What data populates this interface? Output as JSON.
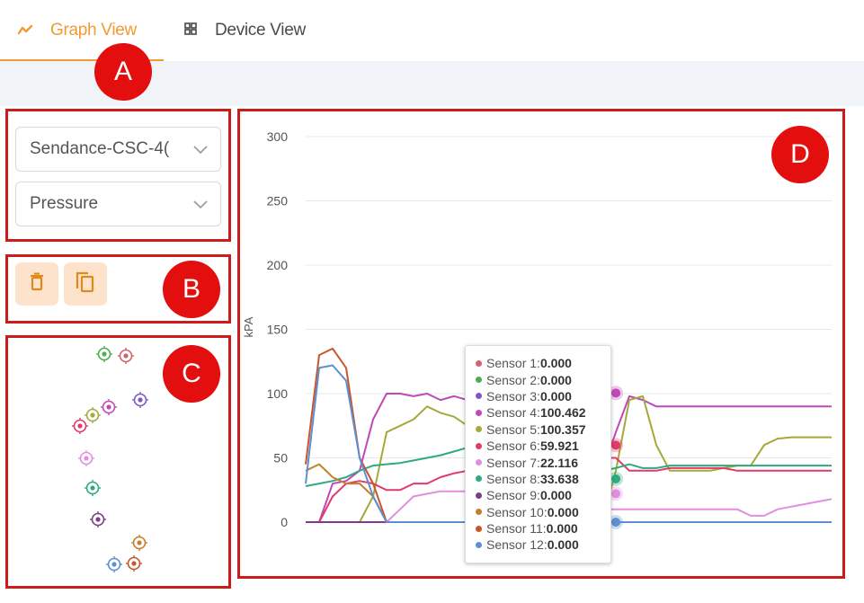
{
  "tabs": {
    "graph_view": {
      "label": "Graph View",
      "icon": "line-chart-icon"
    },
    "device_view": {
      "label": "Device View",
      "icon": "device-grid-icon"
    }
  },
  "annotations": {
    "a": "A",
    "b": "B",
    "c": "C",
    "d": "D"
  },
  "controls": {
    "device_select": {
      "value": "Sendance-CSC-4("
    },
    "measure_select": {
      "value": "Pressure"
    }
  },
  "actions": {
    "delete_icon": "trash-icon",
    "copy_icon": "copy-icon"
  },
  "sensor_markers_icon": "target-icon",
  "accent_color": "#f39a33",
  "chart_data": {
    "type": "line",
    "ylabel": "kPA",
    "xlabel": "",
    "ylim": [
      0,
      300
    ],
    "yticks": [
      0,
      50,
      100,
      150,
      200,
      250,
      300
    ],
    "grid": true,
    "series": [
      {
        "name": "Sensor 1",
        "color": "#d5626b",
        "values": [
          0,
          0,
          0,
          0,
          0,
          0,
          0,
          0,
          0,
          0,
          0,
          0,
          0,
          0,
          0,
          0,
          0,
          0,
          0,
          0,
          0,
          0,
          0,
          0,
          0,
          0,
          0,
          0,
          0,
          0,
          0,
          0,
          0,
          0,
          0,
          0,
          0,
          0,
          0,
          0
        ]
      },
      {
        "name": "Sensor 2",
        "color": "#4caf50",
        "values": [
          0,
          0,
          0,
          0,
          0,
          0,
          0,
          0,
          0,
          0,
          0,
          0,
          0,
          0,
          0,
          0,
          0,
          0,
          0,
          0,
          0,
          0,
          0,
          0,
          0,
          0,
          0,
          0,
          0,
          0,
          0,
          0,
          0,
          0,
          0,
          0,
          0,
          0,
          0,
          0
        ]
      },
      {
        "name": "Sensor 3",
        "color": "#7e57c2",
        "values": [
          0,
          0,
          0,
          0,
          0,
          0,
          0,
          0,
          0,
          0,
          0,
          0,
          0,
          0,
          0,
          0,
          0,
          0,
          0,
          0,
          0,
          0,
          0,
          0,
          0,
          0,
          0,
          0,
          0,
          0,
          0,
          0,
          0,
          0,
          0,
          0,
          0,
          0,
          0,
          0
        ]
      },
      {
        "name": "Sensor 4",
        "color": "#c048b8",
        "values": [
          0,
          0,
          30,
          32,
          40,
          80,
          100,
          100,
          98,
          100,
          95,
          98,
          95,
          90,
          96,
          92,
          98,
          100,
          90,
          60,
          40,
          40,
          40,
          70,
          98,
          95,
          90,
          90,
          90,
          90,
          90,
          90,
          90,
          90,
          90,
          90,
          90,
          90,
          90,
          90
        ]
      },
      {
        "name": "Sensor 5",
        "color": "#a5a83a",
        "values": [
          0,
          0,
          0,
          0,
          0,
          20,
          70,
          75,
          80,
          90,
          85,
          82,
          75,
          70,
          80,
          75,
          80,
          100,
          60,
          20,
          0,
          0,
          0,
          40,
          95,
          98,
          60,
          40,
          40,
          40,
          40,
          42,
          44,
          44,
          60,
          65,
          66,
          66,
          66,
          66
        ]
      },
      {
        "name": "Sensor 6",
        "color": "#e03c6a",
        "values": [
          0,
          0,
          20,
          30,
          32,
          30,
          25,
          25,
          30,
          30,
          35,
          38,
          40,
          40,
          40,
          38,
          40,
          45,
          50,
          60,
          60,
          55,
          50,
          50,
          40,
          40,
          40,
          42,
          42,
          42,
          42,
          42,
          40,
          40,
          40,
          40,
          40,
          40,
          40,
          40
        ]
      },
      {
        "name": "Sensor 7",
        "color": "#e18ee0",
        "values": [
          0,
          0,
          0,
          0,
          0,
          0,
          0,
          10,
          20,
          22,
          24,
          24,
          24,
          22,
          22,
          24,
          22,
          22,
          22,
          22,
          22,
          22,
          10,
          10,
          10,
          10,
          10,
          10,
          10,
          10,
          10,
          10,
          10,
          5,
          5,
          10,
          12,
          14,
          16,
          18
        ]
      },
      {
        "name": "Sensor 8",
        "color": "#2eaa7f",
        "values": [
          28,
          30,
          32,
          35,
          40,
          44,
          45,
          46,
          48,
          50,
          52,
          55,
          58,
          55,
          50,
          50,
          48,
          45,
          40,
          35,
          35,
          38,
          40,
          42,
          45,
          42,
          42,
          44,
          44,
          44,
          44,
          44,
          44,
          44,
          44,
          44,
          44,
          44,
          44,
          44
        ]
      },
      {
        "name": "Sensor 9",
        "color": "#7b3e86",
        "values": [
          0,
          0,
          0,
          0,
          0,
          0,
          0,
          0,
          0,
          0,
          0,
          0,
          0,
          0,
          0,
          0,
          0,
          0,
          0,
          0,
          0,
          0,
          0,
          0,
          0,
          0,
          0,
          0,
          0,
          0,
          0,
          0,
          0,
          0,
          0,
          0,
          0,
          0,
          0,
          0
        ]
      },
      {
        "name": "Sensor 10",
        "color": "#c57f2a",
        "values": [
          40,
          45,
          35,
          30,
          30,
          20,
          0,
          0,
          0,
          0,
          0,
          0,
          0,
          0,
          0,
          0,
          0,
          0,
          30,
          35,
          30,
          20,
          0,
          0,
          0,
          0,
          0,
          0,
          0,
          0,
          0,
          0,
          0,
          0,
          0,
          0,
          0,
          0,
          0,
          0
        ]
      },
      {
        "name": "Sensor 11",
        "color": "#c8552c",
        "values": [
          45,
          130,
          135,
          120,
          50,
          30,
          0,
          0,
          0,
          0,
          0,
          0,
          0,
          0,
          0,
          0,
          0,
          0,
          60,
          65,
          66,
          30,
          0,
          0,
          0,
          0,
          0,
          0,
          0,
          0,
          0,
          0,
          0,
          0,
          0,
          0,
          0,
          0,
          0,
          0
        ]
      },
      {
        "name": "Sensor 12",
        "color": "#5d8fd1",
        "values": [
          30,
          120,
          122,
          110,
          50,
          20,
          0,
          0,
          0,
          0,
          0,
          0,
          0,
          0,
          0,
          0,
          0,
          0,
          0,
          20,
          25,
          10,
          0,
          0,
          0,
          0,
          0,
          0,
          0,
          0,
          0,
          0,
          0,
          0,
          0,
          0,
          0,
          0,
          0,
          0
        ]
      }
    ],
    "tooltip": [
      {
        "label": "Sensor 1:",
        "value": "0.000"
      },
      {
        "label": "Sensor 2:",
        "value": "0.000"
      },
      {
        "label": "Sensor 3:",
        "value": "0.000"
      },
      {
        "label": "Sensor 4:",
        "value": "100.462"
      },
      {
        "label": "Sensor 5:",
        "value": "100.357"
      },
      {
        "label": "Sensor 6:",
        "value": "59.921"
      },
      {
        "label": "Sensor 7:",
        "value": "22.116"
      },
      {
        "label": "Sensor 8:",
        "value": "33.638"
      },
      {
        "label": "Sensor 9:",
        "value": "0.000"
      },
      {
        "label": "Sensor 10:",
        "value": "0.000"
      },
      {
        "label": "Sensor 11:",
        "value": "0.000"
      },
      {
        "label": "Sensor 12:",
        "value": "0.000"
      }
    ]
  }
}
